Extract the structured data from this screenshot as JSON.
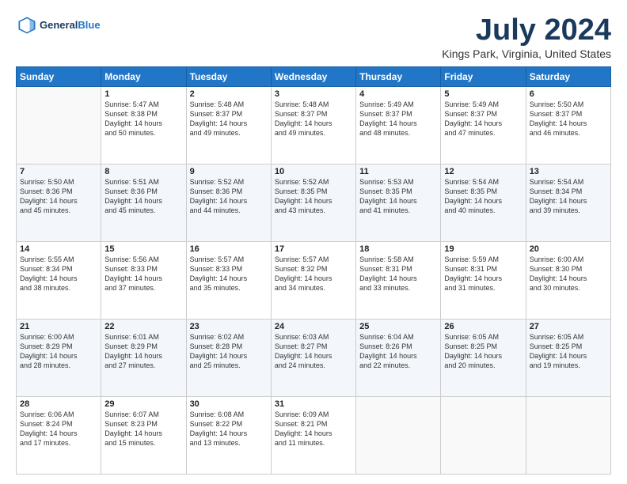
{
  "logo": {
    "line1": "General",
    "line2": "Blue"
  },
  "title": "July 2024",
  "location": "Kings Park, Virginia, United States",
  "days_header": [
    "Sunday",
    "Monday",
    "Tuesday",
    "Wednesday",
    "Thursday",
    "Friday",
    "Saturday"
  ],
  "weeks": [
    [
      {
        "day": "",
        "text": ""
      },
      {
        "day": "1",
        "text": "Sunrise: 5:47 AM\nSunset: 8:38 PM\nDaylight: 14 hours\nand 50 minutes."
      },
      {
        "day": "2",
        "text": "Sunrise: 5:48 AM\nSunset: 8:37 PM\nDaylight: 14 hours\nand 49 minutes."
      },
      {
        "day": "3",
        "text": "Sunrise: 5:48 AM\nSunset: 8:37 PM\nDaylight: 14 hours\nand 49 minutes."
      },
      {
        "day": "4",
        "text": "Sunrise: 5:49 AM\nSunset: 8:37 PM\nDaylight: 14 hours\nand 48 minutes."
      },
      {
        "day": "5",
        "text": "Sunrise: 5:49 AM\nSunset: 8:37 PM\nDaylight: 14 hours\nand 47 minutes."
      },
      {
        "day": "6",
        "text": "Sunrise: 5:50 AM\nSunset: 8:37 PM\nDaylight: 14 hours\nand 46 minutes."
      }
    ],
    [
      {
        "day": "7",
        "text": "Sunrise: 5:50 AM\nSunset: 8:36 PM\nDaylight: 14 hours\nand 45 minutes."
      },
      {
        "day": "8",
        "text": "Sunrise: 5:51 AM\nSunset: 8:36 PM\nDaylight: 14 hours\nand 45 minutes."
      },
      {
        "day": "9",
        "text": "Sunrise: 5:52 AM\nSunset: 8:36 PM\nDaylight: 14 hours\nand 44 minutes."
      },
      {
        "day": "10",
        "text": "Sunrise: 5:52 AM\nSunset: 8:35 PM\nDaylight: 14 hours\nand 43 minutes."
      },
      {
        "day": "11",
        "text": "Sunrise: 5:53 AM\nSunset: 8:35 PM\nDaylight: 14 hours\nand 41 minutes."
      },
      {
        "day": "12",
        "text": "Sunrise: 5:54 AM\nSunset: 8:35 PM\nDaylight: 14 hours\nand 40 minutes."
      },
      {
        "day": "13",
        "text": "Sunrise: 5:54 AM\nSunset: 8:34 PM\nDaylight: 14 hours\nand 39 minutes."
      }
    ],
    [
      {
        "day": "14",
        "text": "Sunrise: 5:55 AM\nSunset: 8:34 PM\nDaylight: 14 hours\nand 38 minutes."
      },
      {
        "day": "15",
        "text": "Sunrise: 5:56 AM\nSunset: 8:33 PM\nDaylight: 14 hours\nand 37 minutes."
      },
      {
        "day": "16",
        "text": "Sunrise: 5:57 AM\nSunset: 8:33 PM\nDaylight: 14 hours\nand 35 minutes."
      },
      {
        "day": "17",
        "text": "Sunrise: 5:57 AM\nSunset: 8:32 PM\nDaylight: 14 hours\nand 34 minutes."
      },
      {
        "day": "18",
        "text": "Sunrise: 5:58 AM\nSunset: 8:31 PM\nDaylight: 14 hours\nand 33 minutes."
      },
      {
        "day": "19",
        "text": "Sunrise: 5:59 AM\nSunset: 8:31 PM\nDaylight: 14 hours\nand 31 minutes."
      },
      {
        "day": "20",
        "text": "Sunrise: 6:00 AM\nSunset: 8:30 PM\nDaylight: 14 hours\nand 30 minutes."
      }
    ],
    [
      {
        "day": "21",
        "text": "Sunrise: 6:00 AM\nSunset: 8:29 PM\nDaylight: 14 hours\nand 28 minutes."
      },
      {
        "day": "22",
        "text": "Sunrise: 6:01 AM\nSunset: 8:29 PM\nDaylight: 14 hours\nand 27 minutes."
      },
      {
        "day": "23",
        "text": "Sunrise: 6:02 AM\nSunset: 8:28 PM\nDaylight: 14 hours\nand 25 minutes."
      },
      {
        "day": "24",
        "text": "Sunrise: 6:03 AM\nSunset: 8:27 PM\nDaylight: 14 hours\nand 24 minutes."
      },
      {
        "day": "25",
        "text": "Sunrise: 6:04 AM\nSunset: 8:26 PM\nDaylight: 14 hours\nand 22 minutes."
      },
      {
        "day": "26",
        "text": "Sunrise: 6:05 AM\nSunset: 8:25 PM\nDaylight: 14 hours\nand 20 minutes."
      },
      {
        "day": "27",
        "text": "Sunrise: 6:05 AM\nSunset: 8:25 PM\nDaylight: 14 hours\nand 19 minutes."
      }
    ],
    [
      {
        "day": "28",
        "text": "Sunrise: 6:06 AM\nSunset: 8:24 PM\nDaylight: 14 hours\nand 17 minutes."
      },
      {
        "day": "29",
        "text": "Sunrise: 6:07 AM\nSunset: 8:23 PM\nDaylight: 14 hours\nand 15 minutes."
      },
      {
        "day": "30",
        "text": "Sunrise: 6:08 AM\nSunset: 8:22 PM\nDaylight: 14 hours\nand 13 minutes."
      },
      {
        "day": "31",
        "text": "Sunrise: 6:09 AM\nSunset: 8:21 PM\nDaylight: 14 hours\nand 11 minutes."
      },
      {
        "day": "",
        "text": ""
      },
      {
        "day": "",
        "text": ""
      },
      {
        "day": "",
        "text": ""
      }
    ]
  ]
}
